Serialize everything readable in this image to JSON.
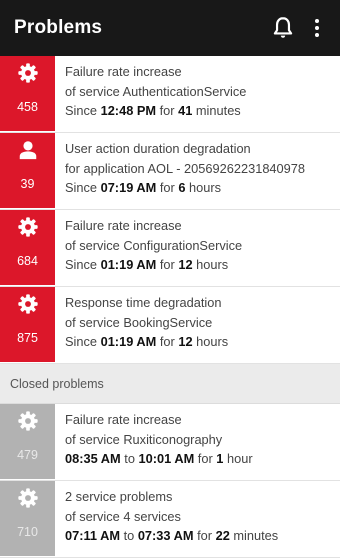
{
  "appbar": {
    "title": "Problems",
    "icons": [
      "bell-icon",
      "more-vert-icon"
    ]
  },
  "open_problems": [
    {
      "count": "458",
      "icon": "gear-icon",
      "line1": "Failure rate increase",
      "line2": "of service AuthenticationService",
      "since_label": "Since ",
      "time": "12:48 PM",
      "for_label": " for ",
      "duration_value": "41",
      "duration_unit": " minutes"
    },
    {
      "count": "39",
      "icon": "user-icon",
      "line1": "User action duration degradation",
      "line2": "for application AOL - 20569262231840978",
      "since_label": "Since ",
      "time": "07:19 AM",
      "for_label": " for ",
      "duration_value": "6",
      "duration_unit": " hours"
    },
    {
      "count": "684",
      "icon": "gear-icon",
      "line1": "Failure rate increase",
      "line2": "of service ConfigurationService",
      "since_label": "Since ",
      "time": "01:19 AM",
      "for_label": " for ",
      "duration_value": "12",
      "duration_unit": " hours"
    },
    {
      "count": "875",
      "icon": "gear-icon",
      "line1": "Response time degradation",
      "line2": "of service BookingService",
      "since_label": "Since ",
      "time": "01:19 AM",
      "for_label": " for ",
      "duration_value": "12",
      "duration_unit": " hours"
    }
  ],
  "closed_section": {
    "title": "Closed problems"
  },
  "closed_problems": [
    {
      "count": "479",
      "icon": "gear-icon",
      "line1": "Failure rate increase",
      "line2": "of service Ruxiticonography",
      "start": "08:35 AM",
      "to_label": " to ",
      "end": "10:01 AM",
      "for_label": " for ",
      "duration_value": "1",
      "duration_unit": " hour"
    },
    {
      "count": "710",
      "icon": "gear-icon",
      "line1": "2 service problems",
      "line2": "of service 4 services",
      "start": "07:11 AM",
      "to_label": " to ",
      "end": "07:33 AM",
      "for_label": " for ",
      "duration_value": "22",
      "duration_unit": " minutes"
    }
  ],
  "colors": {
    "appbar": "#181818",
    "open_badge": "#dc172a",
    "closed_badge": "#b2b2b2",
    "section_bg": "#ebebeb"
  }
}
